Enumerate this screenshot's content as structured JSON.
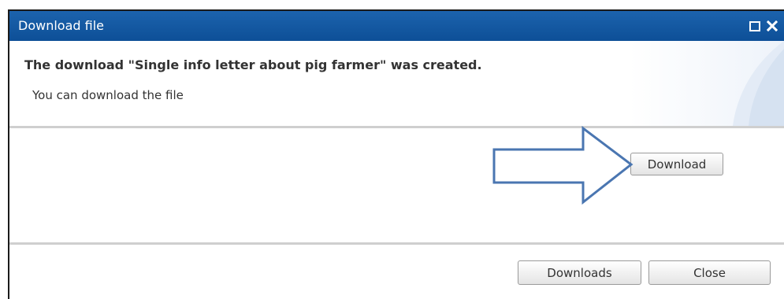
{
  "window": {
    "title": "Download file"
  },
  "message": {
    "heading": "The download \"Single info letter about pig farmer\" was created.",
    "subtext": "You can download the file"
  },
  "buttons": {
    "download": "Download",
    "downloads": "Downloads",
    "close": "Close"
  },
  "icons": {
    "maximize": "maximize-icon",
    "close": "close-icon",
    "annotation_arrow": "arrow-right-outline"
  },
  "colors": {
    "titlebar": "#0d4f97",
    "arrow_stroke": "#4a76b1",
    "divider": "#cfcfcf"
  }
}
